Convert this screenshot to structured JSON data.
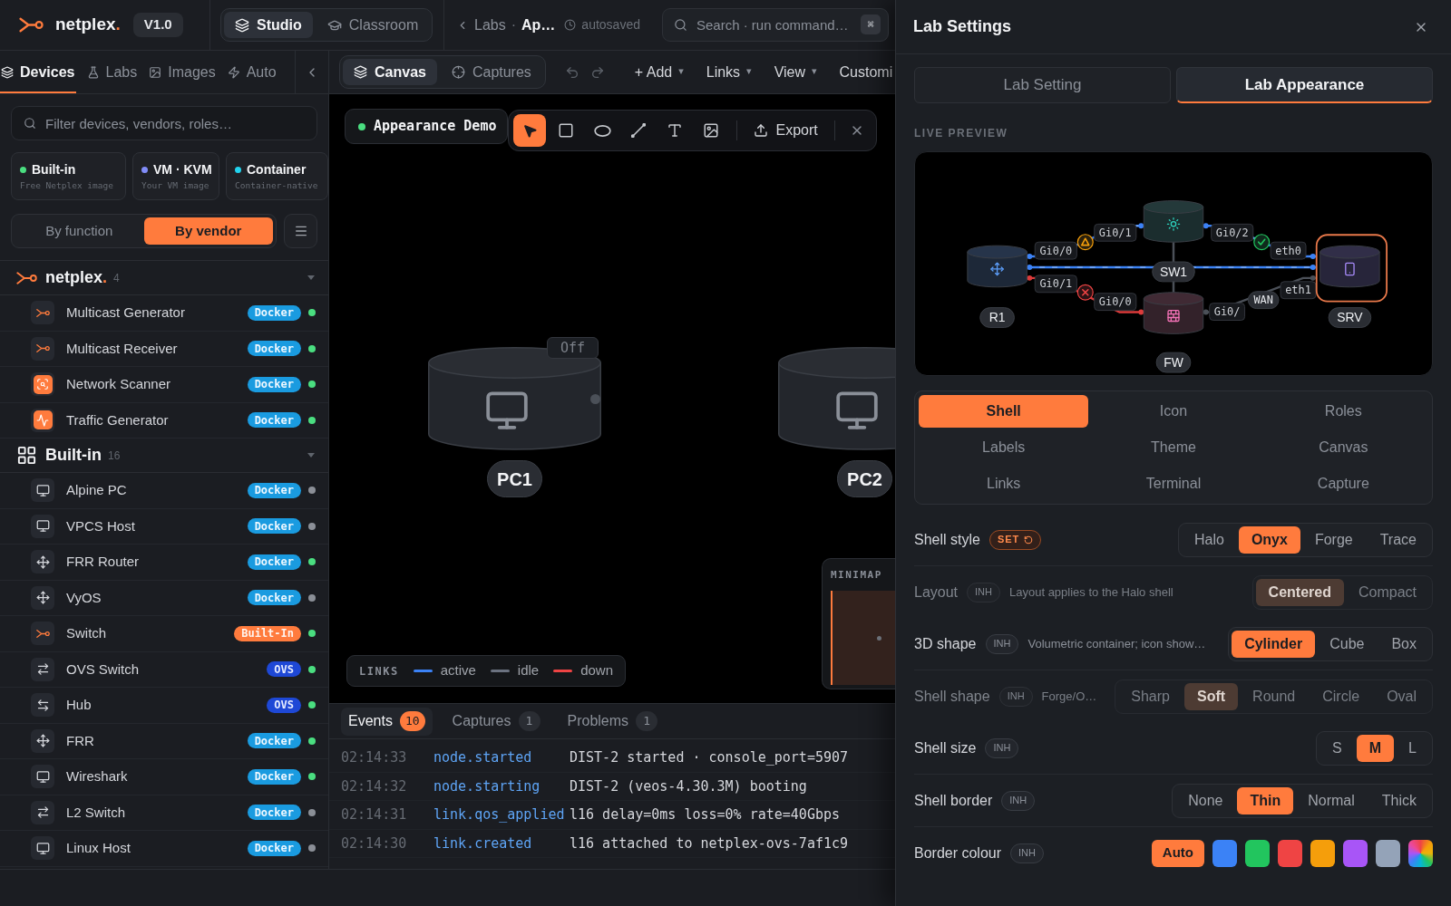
{
  "header": {
    "brand": {
      "name": "netplex",
      "dot": "."
    },
    "version": "V1.0",
    "modes": [
      {
        "label": "Studio",
        "kind": "studio",
        "selected": true
      },
      {
        "label": "Classroom",
        "kind": "classroom",
        "selected": false
      }
    ],
    "breadcrumb": {
      "parent": "Labs",
      "separator": "·",
      "current": "Ap…",
      "status": "autosaved"
    },
    "search": {
      "placeholder": "Search · run command…",
      "shortcut": "⌘"
    }
  },
  "sidebar": {
    "tabs": [
      {
        "label": "Devices",
        "kind": "devices",
        "selected": true
      },
      {
        "label": "Labs",
        "kind": "labs",
        "selected": false
      },
      {
        "label": "Images",
        "kind": "images",
        "selected": false
      },
      {
        "label": "Auto",
        "kind": "auto",
        "selected": false
      }
    ],
    "filter": {
      "placeholder": "Filter devices, vendors, roles…"
    },
    "sources": [
      {
        "title": "Built-in",
        "subtitle": "Free Netplex image",
        "color": "#4ade80"
      },
      {
        "title": "VM · KVM",
        "subtitle": "Your VM image",
        "color": "#818cf8"
      },
      {
        "title": "Container",
        "subtitle": "Container-native",
        "color": "#22d3ee"
      }
    ],
    "grouping": [
      {
        "label": "By function",
        "selected": false
      },
      {
        "label": "By vendor",
        "selected": true
      }
    ],
    "groups": [
      {
        "kind": "brand",
        "name": "netplex",
        "dot": ".",
        "count": "4",
        "expanded": true,
        "items": [
          {
            "name": "Multicast Generator",
            "kind": "multicast",
            "tag": {
              "label": "Docker",
              "kind": "docker"
            },
            "color": "#4ade80"
          },
          {
            "name": "Multicast Receiver",
            "kind": "multicast",
            "tag": {
              "label": "Docker",
              "kind": "docker"
            },
            "color": "#4ade80"
          },
          {
            "name": "Network Scanner",
            "kind": "scanner",
            "tag": {
              "label": "Docker",
              "kind": "docker"
            },
            "color": "#4ade80"
          },
          {
            "name": "Traffic Generator",
            "kind": "traffic",
            "tag": {
              "label": "Docker",
              "kind": "docker"
            },
            "color": "#4ade80"
          }
        ]
      },
      {
        "kind": "grid",
        "name": "Built-in",
        "count": "16",
        "expanded": true,
        "items": [
          {
            "name": "Alpine PC",
            "kind": "host",
            "tag": {
              "label": "Docker",
              "kind": "docker"
            },
            "color": "#8b8f97"
          },
          {
            "name": "VPCS Host",
            "kind": "host",
            "tag": {
              "label": "Docker",
              "kind": "docker"
            },
            "color": "#8b8f97"
          },
          {
            "name": "FRR Router",
            "kind": "router",
            "tag": {
              "label": "Docker",
              "kind": "docker"
            },
            "color": "#4ade80"
          },
          {
            "name": "VyOS",
            "kind": "router",
            "tag": {
              "label": "Docker",
              "kind": "docker"
            },
            "color": "#8b8f97"
          },
          {
            "name": "Switch",
            "kind": "switch",
            "tag": {
              "label": "Built-In",
              "kind": "builtin"
            },
            "color": "#4ade80"
          },
          {
            "name": "OVS Switch",
            "kind": "ovs",
            "tag": {
              "label": "OVS",
              "kind": "ovs"
            },
            "color": "#4ade80"
          },
          {
            "name": "Hub",
            "kind": "hub",
            "tag": {
              "label": "OVS",
              "kind": "ovs"
            },
            "color": "#4ade80"
          },
          {
            "name": "FRR",
            "kind": "router",
            "tag": {
              "label": "Docker",
              "kind": "docker"
            },
            "color": "#4ade80"
          },
          {
            "name": "Wireshark",
            "kind": "host",
            "tag": {
              "label": "Docker",
              "kind": "docker"
            },
            "color": "#4ade80"
          },
          {
            "name": "L2 Switch",
            "kind": "ovs",
            "tag": {
              "label": "Docker",
              "kind": "docker"
            },
            "color": "#8b8f97"
          },
          {
            "name": "Linux Host",
            "kind": "host",
            "tag": {
              "label": "Docker",
              "kind": "docker"
            },
            "color": "#8b8f97"
          }
        ]
      }
    ]
  },
  "workspace": {
    "tabs": [
      {
        "label": "Canvas",
        "kind": "canvas",
        "selected": true
      },
      {
        "label": "Captures",
        "kind": "captures",
        "selected": false
      }
    ],
    "menus": [
      {
        "label": "+ Add",
        "caret": "▾"
      },
      {
        "label": "Links",
        "caret": "▾"
      },
      {
        "label": "View",
        "caret": "▾"
      },
      {
        "label": "Customi"
      }
    ],
    "lab": {
      "name": "Appearance Demo",
      "running": true
    },
    "tools": [
      {
        "kind": "select",
        "selected": true
      },
      {
        "kind": "rectangle",
        "selected": false
      },
      {
        "kind": "ellipse",
        "selected": false
      },
      {
        "kind": "line",
        "selected": false
      },
      {
        "kind": "text",
        "selected": false
      },
      {
        "kind": "image",
        "selected": false
      }
    ],
    "export": "Export",
    "nodes": [
      {
        "label": "PC1",
        "status": "Off",
        "handle": true
      },
      {
        "label": "PC2"
      }
    ],
    "legend": {
      "title": "LINKS",
      "items": [
        {
          "label": "active",
          "color": "#3b82f6"
        },
        {
          "label": "idle",
          "color": "#6b7280"
        },
        {
          "label": "down",
          "color": "#ef4444"
        }
      ]
    },
    "minimap": {
      "title": "MINIMAP"
    }
  },
  "log": {
    "tabs": [
      {
        "label": "Events",
        "count": "10",
        "selected": true
      },
      {
        "label": "Captures",
        "count": "1",
        "selected": false
      },
      {
        "label": "Problems",
        "count": "1",
        "selected": false
      }
    ],
    "rows": [
      {
        "time": "02:14:33",
        "type": "node.started",
        "message": "DIST-2 started · console_port=5907"
      },
      {
        "time": "02:14:32",
        "type": "node.starting",
        "message": "DIST-2 (veos-4.30.3M) booting"
      },
      {
        "time": "02:14:31",
        "type": "link.qos_applied",
        "message": "l16 delay=0ms loss=0% rate=40Gbps"
      },
      {
        "time": "02:14:30",
        "type": "link.created",
        "message": "l16 attached to netplex-ovs-7af1c9"
      }
    ]
  },
  "settings": {
    "title": "Lab Settings",
    "tabs": [
      {
        "label": "Lab Setting",
        "selected": false
      },
      {
        "label": "Lab Appearance",
        "selected": true
      }
    ],
    "preview": {
      "title": "LIVE PREVIEW",
      "nodes": [
        {
          "label": "R1",
          "kind": "router",
          "selected": false
        },
        {
          "label": "SW1",
          "kind": "switch",
          "selected": false
        },
        {
          "label": "FW",
          "kind": "firewall",
          "selected": false
        },
        {
          "label": "SRV",
          "kind": "server",
          "selected": true
        }
      ],
      "links": [
        {
          "kind": "active",
          "ports": [
            "Gi0/0",
            "Gi0/1"
          ],
          "marker": {
            "kind": "warning"
          }
        },
        {
          "kind": "down",
          "ports": [
            "Gi0/1",
            "Gi0/0"
          ],
          "marker": {
            "kind": "error"
          }
        },
        {
          "kind": "active",
          "ports": [
            "Gi0/2",
            "eth0"
          ],
          "marker": {
            "kind": "ok"
          }
        },
        {
          "kind": "idle",
          "ports": [
            "Gi0/",
            "eth1"
          ],
          "tag": "WAN"
        },
        {
          "kind": "active"
        },
        {
          "kind": "idle"
        }
      ]
    },
    "categories": [
      {
        "label": "Shell",
        "selected": true
      },
      {
        "label": "Icon",
        "selected": false
      },
      {
        "label": "Roles",
        "selected": false
      },
      {
        "label": "Labels",
        "selected": false
      },
      {
        "label": "Theme",
        "selected": false
      },
      {
        "label": "Canvas",
        "selected": false
      },
      {
        "label": "Links",
        "selected": false
      },
      {
        "label": "Terminal",
        "selected": false
      },
      {
        "label": "Capture",
        "selected": false
      }
    ],
    "sections": [
      {
        "rows": [
          {
            "kind": "segmented",
            "label": "Shell style",
            "badge": {
              "label": "SET",
              "kind": "set"
            },
            "disabled": false,
            "options": [
              {
                "label": "Halo",
                "selected": false
              },
              {
                "label": "Onyx",
                "selected": true
              },
              {
                "label": "Forge",
                "selected": false
              },
              {
                "label": "Trace",
                "selected": false
              }
            ]
          }
        ]
      },
      {
        "rows": [
          {
            "kind": "segmented",
            "label": "Layout",
            "badge": {
              "label": "INH",
              "kind": "inherited"
            },
            "hint": "Layout applies to the Halo shell",
            "disabled": true,
            "options": [
              {
                "label": "Centered",
                "selected": true
              },
              {
                "label": "Compact",
                "selected": false
              }
            ]
          },
          {
            "kind": "segmented",
            "label": "3D shape",
            "badge": {
              "label": "INH",
              "kind": "inherited"
            },
            "hint": "Volumetric container; icon show…",
            "disabled": false,
            "options": [
              {
                "label": "Cylinder",
                "selected": true
              },
              {
                "label": "Cube",
                "selected": false
              },
              {
                "label": "Box",
                "selected": false
              }
            ]
          }
        ]
      },
      {
        "rows": [
          {
            "kind": "segmented",
            "label": "Shell shape",
            "badge": {
              "label": "INH",
              "kind": "inherited"
            },
            "hint": "Forge/O…",
            "disabled": true,
            "options": [
              {
                "label": "Sharp",
                "selected": false
              },
              {
                "label": "Soft",
                "selected": true
              },
              {
                "label": "Round",
                "selected": false
              },
              {
                "label": "Circle",
                "selected": false
              },
              {
                "label": "Oval",
                "selected": false
              }
            ]
          },
          {
            "kind": "segmented",
            "label": "Shell size",
            "badge": {
              "label": "INH",
              "kind": "inherited"
            },
            "disabled": false,
            "options": [
              {
                "label": "S",
                "selected": false
              },
              {
                "label": "M",
                "selected": true
              },
              {
                "label": "L",
                "selected": false
              }
            ]
          }
        ]
      },
      {
        "rows": [
          {
            "kind": "segmented",
            "label": "Shell border",
            "badge": {
              "label": "INH",
              "kind": "inherited"
            },
            "disabled": false,
            "options": [
              {
                "label": "None",
                "selected": false
              },
              {
                "label": "Thin",
                "selected": true
              },
              {
                "label": "Normal",
                "selected": false
              },
              {
                "label": "Thick",
                "selected": false
              }
            ]
          }
        ]
      },
      {
        "rows": [
          {
            "kind": "swatches",
            "label": "Border colour",
            "badge": {
              "label": "INH",
              "kind": "inherited"
            },
            "disabled": false,
            "swatches": [
              {
                "kind": "auto",
                "label": "Auto",
                "selected": true
              },
              {
                "kind": "solid",
                "color": "#3b82f6",
                "selected": false
              },
              {
                "kind": "solid",
                "color": "#22c55e",
                "selected": false
              },
              {
                "kind": "solid",
                "color": "#ef4444",
                "selected": false
              },
              {
                "kind": "solid",
                "color": "#f59e0b",
                "selected": false
              },
              {
                "kind": "solid",
                "color": "#a855f7",
                "selected": false
              },
              {
                "kind": "solid",
                "color": "#94a3b8",
                "selected": false
              },
              {
                "kind": "custom",
                "selected": false
              }
            ]
          }
        ]
      }
    ]
  }
}
